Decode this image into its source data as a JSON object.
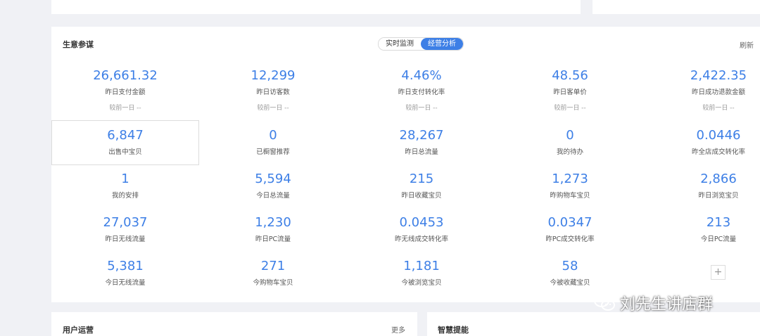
{
  "main": {
    "title": "生意参谋",
    "toggle": {
      "option1": "实时监测",
      "option2": "经营分析"
    },
    "refresh_label": "刷新",
    "compare_label": "较前一日 --",
    "rows": [
      [
        {
          "value": "26,661.32",
          "label": "昨日支付金额"
        },
        {
          "value": "12,299",
          "label": "昨日访客数"
        },
        {
          "value": "4.46%",
          "label": "昨日支付转化率"
        },
        {
          "value": "48.56",
          "label": "昨日客单价"
        },
        {
          "value": "2,422.35",
          "label": "昨日成功退款金额"
        }
      ],
      [
        {
          "value": "6,847",
          "label": "出售中宝贝"
        },
        {
          "value": "0",
          "label": "已橱窗推荐"
        },
        {
          "value": "28,267",
          "label": "昨日总流量"
        },
        {
          "value": "0",
          "label": "我的待办"
        },
        {
          "value": "0.0446",
          "label": "昨全店成交转化率"
        }
      ],
      [
        {
          "value": "1",
          "label": "我的安排"
        },
        {
          "value": "5,594",
          "label": "今日总流量"
        },
        {
          "value": "215",
          "label": "昨日收藏宝贝"
        },
        {
          "value": "1,273",
          "label": "昨购物车宝贝"
        },
        {
          "value": "2,866",
          "label": "昨日浏览宝贝"
        }
      ],
      [
        {
          "value": "27,037",
          "label": "昨日无线流量"
        },
        {
          "value": "1,230",
          "label": "昨日PC流量"
        },
        {
          "value": "0.0453",
          "label": "昨无线成交转化率"
        },
        {
          "value": "0.0347",
          "label": "昨PC成交转化率"
        },
        {
          "value": "213",
          "label": "今日PC流量"
        }
      ],
      [
        {
          "value": "5,381",
          "label": "今日无线流量"
        },
        {
          "value": "271",
          "label": "今购物车宝贝"
        },
        {
          "value": "1,181",
          "label": "今被浏览宝贝"
        },
        {
          "value": "58",
          "label": "今被收藏宝贝"
        }
      ]
    ],
    "add_label": "+"
  },
  "user_ops": {
    "title": "用户运营",
    "more_label": "更多"
  },
  "smart": {
    "title": "智慧提能"
  },
  "watermark": {
    "text": "刘先生讲店群"
  },
  "icons": {
    "add": "plus-icon",
    "watermark_logo": "wechat-icon"
  },
  "colors": {
    "accent": "#3d7fe6",
    "background": "#f0f1f5"
  }
}
